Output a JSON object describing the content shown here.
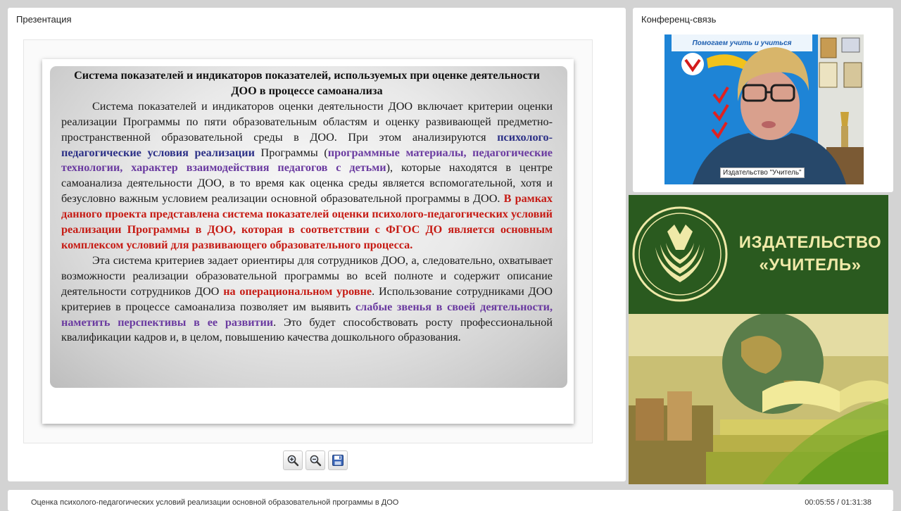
{
  "presentation": {
    "panel_title": "Презентация",
    "slide": {
      "title": "Система показателей и индикаторов показателей, используемых при оценке деятельности ДОО в процессе самоанализа",
      "p1": {
        "t1": "Система показателей и индикаторов оценки деятельности ДОО включает критерии оценки реализации Программы по пяти образовательным областям и оценку развивающей предметно-пространственной образовательной среды в ДОО. При этом анализируются ",
        "h1": "психолого-педагогические условия реализации",
        "t2": " Программы (",
        "h2": "программные материалы, педагогические технологии, характер взаимодействия педагогов с детьми",
        "t3": "), которые находятся в центре самоанализа деятельности ДОО, в то время как оценка среды является вспомогательной, хотя и безусловно важным условием реализации основной образовательной программы в ДОО. ",
        "h3": "В рамках данного проекта представлена система показателей оценки психолого-педагогических условий реализации Программы в ДОО, которая в соответствии с ФГОС ДО является основным комплексом условий для развивающего образовательного процесса."
      },
      "p2": {
        "t1": "Эта система критериев задает ориентиры для сотрудников ДОО, а, следовательно, охватывает возможности реализации образовательной программы во всей полноте и содержит описание деятельности сотрудников ДОО ",
        "h1": "на операциональном уровне",
        "t2": ". Использование сотрудниками ДОО критериев в процессе самоанализа позволяет им выявить ",
        "h2": "слабые звенья в своей деятельности, наметить перспективы в ее развитии",
        "t3": ". Это будет способствовать росту профессиональной квалификации кадров и, в целом, повышению качества дошкольного образования."
      }
    },
    "toolbar": {
      "zoom_in_icon": "zoom-in-icon",
      "zoom_out_icon": "zoom-out-icon",
      "save_icon": "save-icon"
    }
  },
  "conference": {
    "panel_title": "Конференц-связь",
    "video_label": "Издательство \"Учитель\"",
    "poster_line": "Помогаем учить и учиться"
  },
  "banner": {
    "name_line1": "ИЗДАТЕЛЬСТВО",
    "name_line2": "«УЧИТЕЛЬ»",
    "brand_color": "#2a5a1f",
    "text_color": "#efe9a8"
  },
  "footer": {
    "title": "Оценка психолого-педагогических условий реализации основной образовательной программы в ДОО",
    "time": "00:05:55 / 01:31:38"
  }
}
